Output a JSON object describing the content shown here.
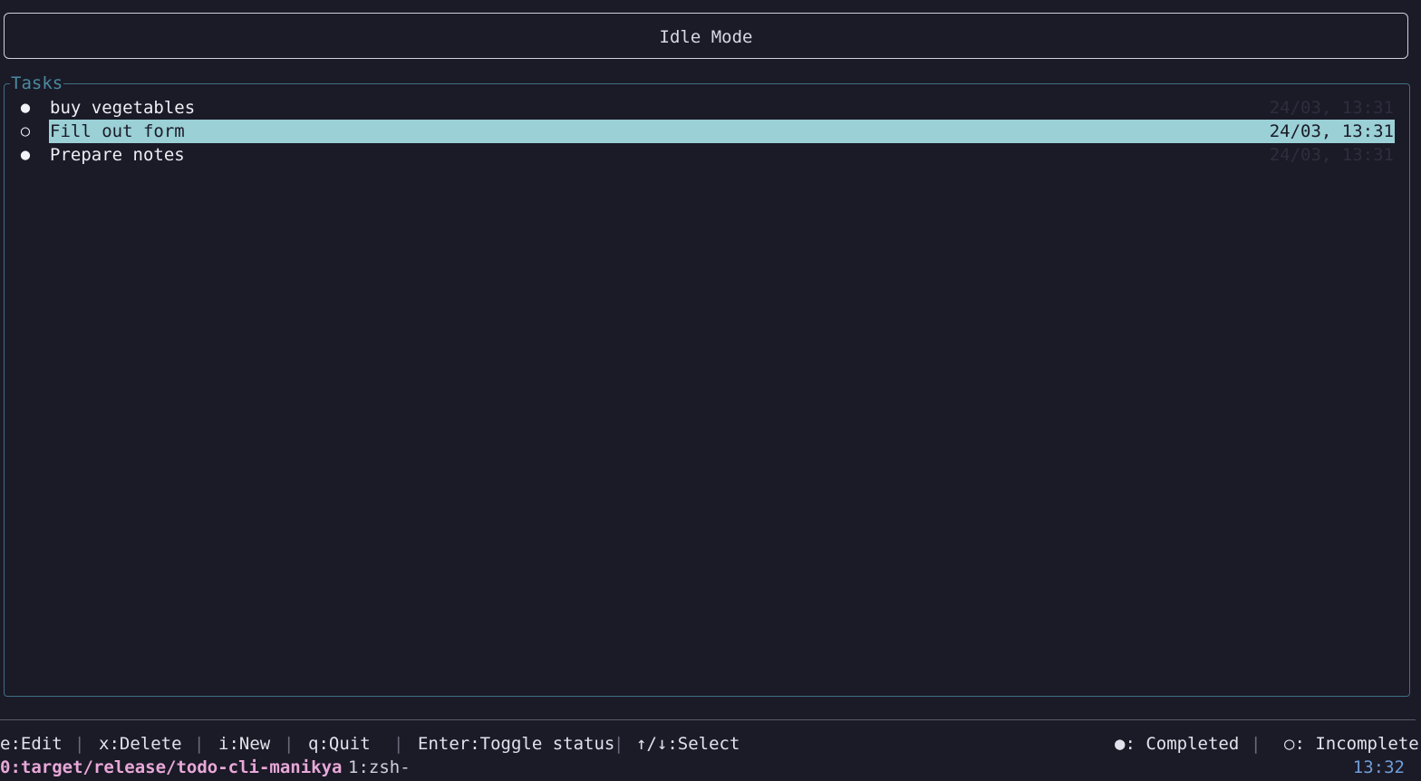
{
  "header": {
    "mode": "Idle Mode"
  },
  "tasks_panel": {
    "title": "Tasks",
    "items": [
      {
        "marker": "●",
        "label": "buy vegetables",
        "time": "24/03, 13:31",
        "selected": false
      },
      {
        "marker": "○",
        "label": "Fill out form",
        "time": "24/03, 13:31",
        "selected": true
      },
      {
        "marker": "●",
        "label": "Prepare notes",
        "time": "24/03, 13:31",
        "selected": false
      }
    ]
  },
  "help_bar": {
    "edit": "e:Edit",
    "delete": "x:Delete",
    "new": "i:New",
    "quit": "q:Quit",
    "toggle": "Enter:Toggle status",
    "select": "↑/↓:Select",
    "legend_completed": "●: Completed",
    "legend_incomplete": "○: Incomplete",
    "separator": "|"
  },
  "tmux": {
    "active_window": "0:target/release/todo-cli-manikya",
    "other_window": "1:zsh-",
    "clock": "13:32"
  },
  "colors": {
    "background": "#1b1a27",
    "selection": "#9ad0d6",
    "panel_border": "#3f6f82",
    "tmux_active": "#e8a8d8",
    "clock": "#6f9ed8"
  }
}
